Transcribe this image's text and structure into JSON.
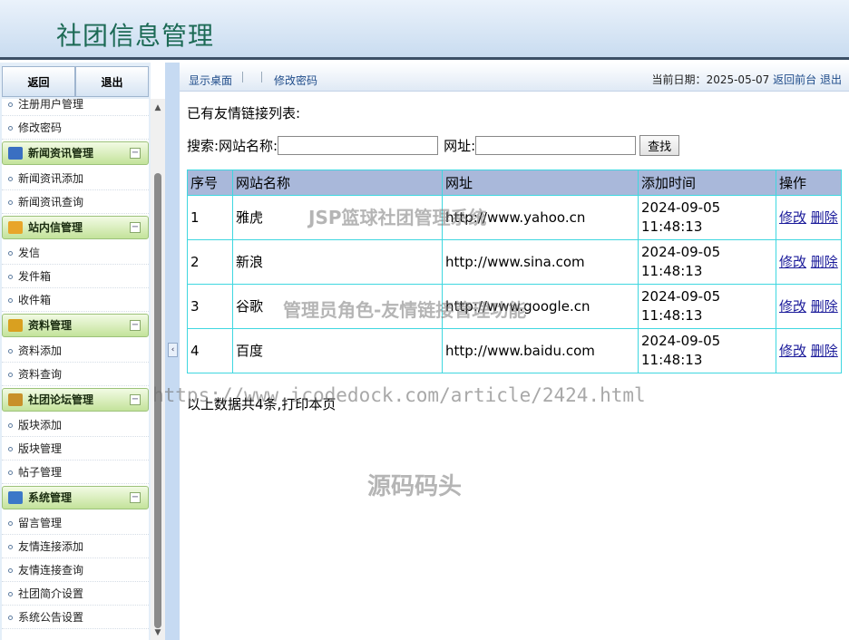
{
  "header": {
    "title": "社团信息管理"
  },
  "sidebar": {
    "top_buttons": [
      "返回",
      "退出"
    ],
    "partial_item": "注册用户管理",
    "top_item": "修改密码",
    "groups": [
      {
        "title": "新闻资讯管理",
        "icon": "monitor-icon",
        "color": "#3a6fc2",
        "items": [
          "新闻资讯添加",
          "新闻资讯查询"
        ]
      },
      {
        "title": "站内信管理",
        "icon": "folder-icon",
        "color": "#e8a52a",
        "items": [
          "发信",
          "发件箱",
          "收件箱"
        ]
      },
      {
        "title": "资料管理",
        "icon": "database-icon",
        "color": "#d9a020",
        "items": [
          "资料添加",
          "资料查询"
        ]
      },
      {
        "title": "社团论坛管理",
        "icon": "users-icon",
        "color": "#c8902a",
        "items": [
          "版块添加",
          "版块管理",
          "帖子管理"
        ]
      },
      {
        "title": "系统管理",
        "icon": "chart-icon",
        "color": "#3c78c8",
        "items": [
          "留言管理",
          "友情连接添加",
          "友情连接查询",
          "社团简介设置",
          "系统公告设置"
        ]
      }
    ],
    "toggle_symbol": "−"
  },
  "toolbar": {
    "desktop_link": "显示桌面",
    "password_link": "修改密码",
    "date_label": "当前日期：",
    "date_value": "2025-05-07",
    "back_link": "返回前台",
    "logout_link": "退出"
  },
  "main": {
    "heading": "已有友情链接列表:",
    "search_label": "搜索:网站名称:",
    "url_label": "网址:",
    "name_value": "",
    "url_value": "",
    "search_button": "查找",
    "columns": [
      "序号",
      "网站名称",
      "网址",
      "添加时间",
      "操作"
    ],
    "rows": [
      {
        "no": "1",
        "name": "雅虎",
        "url": "http://www.yahoo.cn",
        "date": "2024-09-05",
        "time": "11:48:13"
      },
      {
        "no": "2",
        "name": "新浪",
        "url": "http://www.sina.com",
        "date": "2024-09-05",
        "time": "11:48:13"
      },
      {
        "no": "3",
        "name": "谷歌",
        "url": "http://www.google.cn",
        "date": "2024-09-05",
        "time": "11:48:13"
      },
      {
        "no": "4",
        "name": "百度",
        "url": "http://www.baidu.com",
        "date": "2024-09-05",
        "time": "11:48:13"
      }
    ],
    "edit_label": "修改",
    "delete_label": "删除",
    "footer_prefix": "以上数据共4条,",
    "print_link": "打印本页"
  },
  "watermarks": {
    "w1": "JSP篮球社团管理系统",
    "w2": "管理员角色-友情链接管理功能",
    "w3": "https://www.icodedock.com/article/2424.html",
    "w4": "源码码头"
  }
}
